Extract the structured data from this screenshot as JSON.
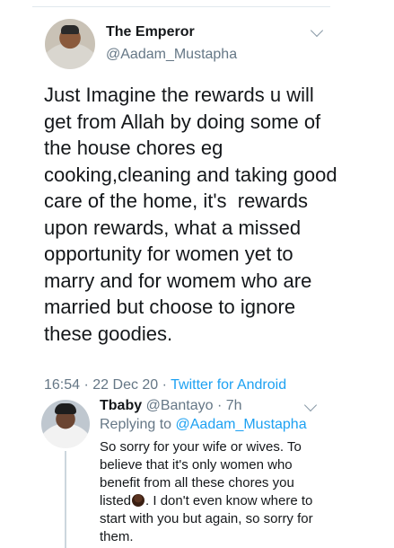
{
  "tweet": {
    "author_name": "The Emperor",
    "author_handle": "@Aadam_Mustapha",
    "text": "Just Imagine the rewards u will get from Allah by doing some of the house chores eg cooking,cleaning and taking good care of the home, it's  rewards upon rewards, what a missed opportunity for women yet to marry and for womem who are married but choose to ignore these goodies.",
    "time": "16:54",
    "date": "22 Dec 20",
    "separator": " · ",
    "client": "Twitter for Android"
  },
  "reply": {
    "author_name": "Tbaby",
    "author_handle": "@Bantayo",
    "age": "7h",
    "age_separator": " · ",
    "replying_prefix": "Replying to ",
    "replying_to": "@Aadam_Mustapha",
    "text_part1": "So sorry for your wife or wives. To believe that it's only women who benefit from all these chores you listed",
    "emoji": "person-facepalming-emoji",
    "text_part2": ". I don't even know where to start with you but again, so sorry for them."
  },
  "colors": {
    "link": "#1da1f2",
    "secondary_text": "#657786",
    "primary_text": "#14171a"
  }
}
